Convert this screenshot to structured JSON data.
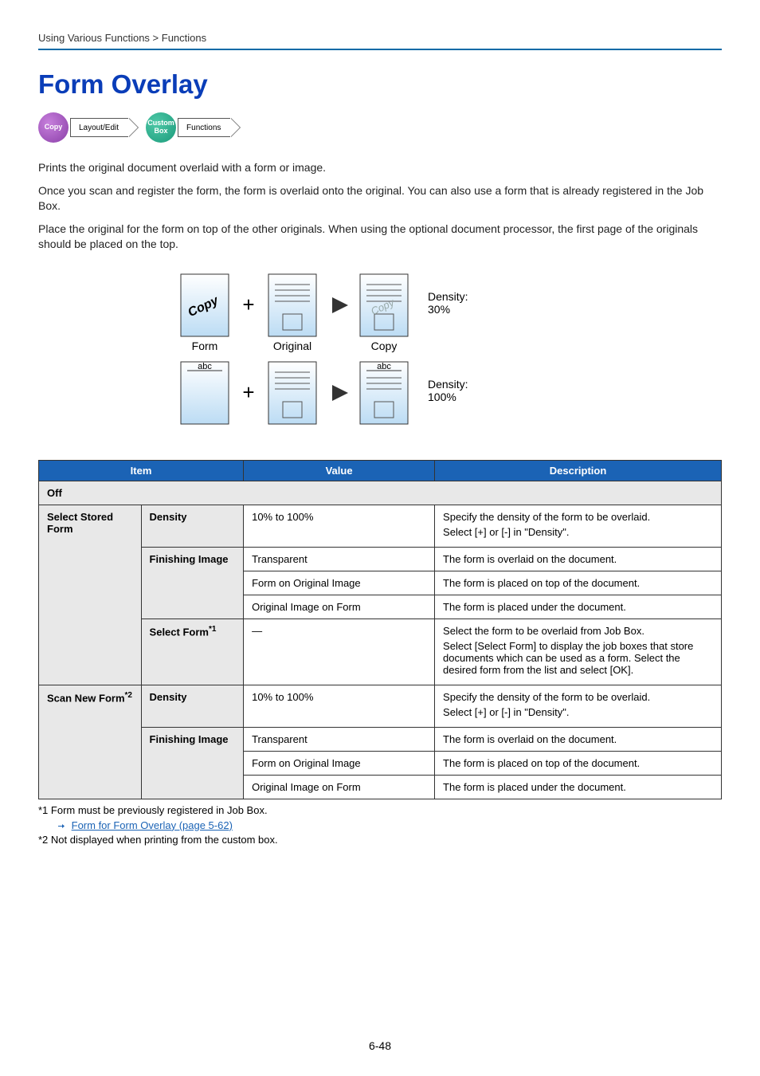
{
  "breadcrumb": "Using Various Functions > Functions",
  "heading": "Form Overlay",
  "chips": {
    "copy": "Copy",
    "layout": "Layout/Edit",
    "custom": "Custom\nBox",
    "functions": "Functions"
  },
  "paras": {
    "p1": "Prints the original document overlaid with a form or image.",
    "p2": "Once you scan and register the form, the form is overlaid onto the original. You can also use a form that is already registered in the Job Box.",
    "p3": "Place the original for the form on top of the other originals. When using the optional document processor, the first page of the originals should be placed on the top."
  },
  "diagram": {
    "form_label": "Form",
    "original_label": "Original",
    "copy_label": "Copy",
    "abc": "abc",
    "copy_word": "Copy",
    "density30": "Density:\n30%",
    "density100": "Density:\n100%"
  },
  "table": {
    "headers": {
      "item": "Item",
      "value": "Value",
      "description": "Description"
    },
    "off": "Off",
    "select_stored_form": "Select Stored Form",
    "scan_new_form": "Scan New Form",
    "scan_new_form_sup": "*2",
    "density_label": "Density",
    "density_value": "10% to 100%",
    "density_desc_1": "Specify the density of the form to be overlaid.",
    "density_desc_2": "Select [+] or [-] in \"Density\".",
    "finishing_label": "Finishing Image",
    "transparent": "Transparent",
    "transparent_desc": "The form is overlaid on the document.",
    "form_on_original": "Form on Original Image",
    "form_on_original_desc": "The form is placed on top of the document.",
    "original_on_form": "Original Image on Form",
    "original_on_form_desc": "The form is placed under the document.",
    "select_form_label": "Select Form",
    "select_form_sup": "*1",
    "select_form_value": "―",
    "select_form_desc_1": "Select the form to be overlaid from Job Box.",
    "select_form_desc_2": "Select [Select Form] to display the job boxes that store documents which can be used as a form. Select the desired form from the list and select [OK]."
  },
  "footnotes": {
    "f1": "*1  Form must be previously registered in Job Box.",
    "f1_link": "Form for Form Overlay (page 5-62)",
    "f2": "*2  Not displayed when printing from the custom box."
  },
  "pagenum": "6-48"
}
